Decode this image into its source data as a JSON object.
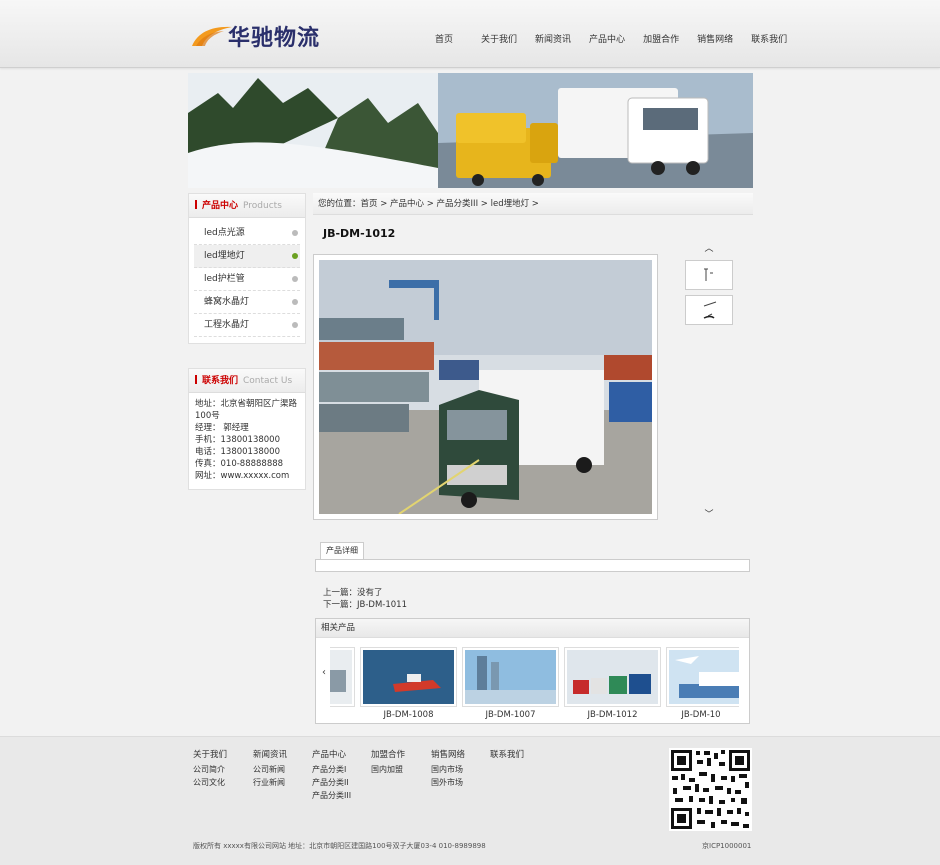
{
  "logo": {
    "text": "华驰物流"
  },
  "nav": [
    "首页",
    "关于我们",
    "新闻资讯",
    "产品中心",
    "加盟合作",
    "销售网络",
    "联系我们"
  ],
  "sidebar": {
    "products": {
      "title_cn": "产品中心",
      "title_en": "Products",
      "items": [
        {
          "label": "led点光源",
          "active": false
        },
        {
          "label": "led埋地灯",
          "active": true
        },
        {
          "label": "led护栏管",
          "active": false
        },
        {
          "label": "蜂窝水晶灯",
          "active": false
        },
        {
          "label": "工程水晶灯",
          "active": false
        }
      ]
    },
    "contact": {
      "title_cn": "联系我们",
      "title_en": "Contact Us",
      "lines": [
        "地址：北京省朝阳区广渠路",
        "100号",
        "经理： 郭经理",
        "手机：13800138000",
        "电话：13800138000",
        "传真：010-88888888",
        "网址：www.xxxxx.com"
      ]
    }
  },
  "breadcrumb": "您的位置：首页 > 产品中心 > 产品分类III > led埋地灯 >",
  "product": {
    "title": "JB-DM-1012",
    "tab_label": "产品详细",
    "prev": "上一篇：没有了",
    "next": "下一篇：JB-DM-1011"
  },
  "thumb_arrows": {
    "up": "︿",
    "down": "﹀"
  },
  "related": {
    "title": "相关产品",
    "left_arrow": "‹",
    "right_arrow": "›",
    "items": [
      {
        "name": ""
      },
      {
        "name": "JB-DM-1008"
      },
      {
        "name": "JB-DM-1007"
      },
      {
        "name": "JB-DM-1012"
      },
      {
        "name": "JB-DM-10"
      }
    ]
  },
  "footer": {
    "columns": [
      {
        "title": "关于我们",
        "links": [
          "公司简介",
          "公司文化"
        ]
      },
      {
        "title": "新闻资讯",
        "links": [
          "公司新闻",
          "行业新闻"
        ]
      },
      {
        "title": "产品中心",
        "links": [
          "产品分类I",
          "产品分类II",
          "产品分类III"
        ]
      },
      {
        "title": "加盟合作",
        "links": [
          "国内加盟"
        ]
      },
      {
        "title": "销售网络",
        "links": [
          "国内市场",
          "国外市场"
        ]
      },
      {
        "title": "联系我们",
        "links": []
      }
    ],
    "copyright": "版权所有 xxxxx有限公司网站 地址：北京市朝阳区建国路100号双子大厦03-4 010-8989898",
    "icp": "京ICP1000001"
  },
  "colors": {
    "accent_red": "#cc0000",
    "logo_blue": "#2a2f6b",
    "logo_orange": "#f39a1e",
    "active_dot": "#6aa020"
  }
}
